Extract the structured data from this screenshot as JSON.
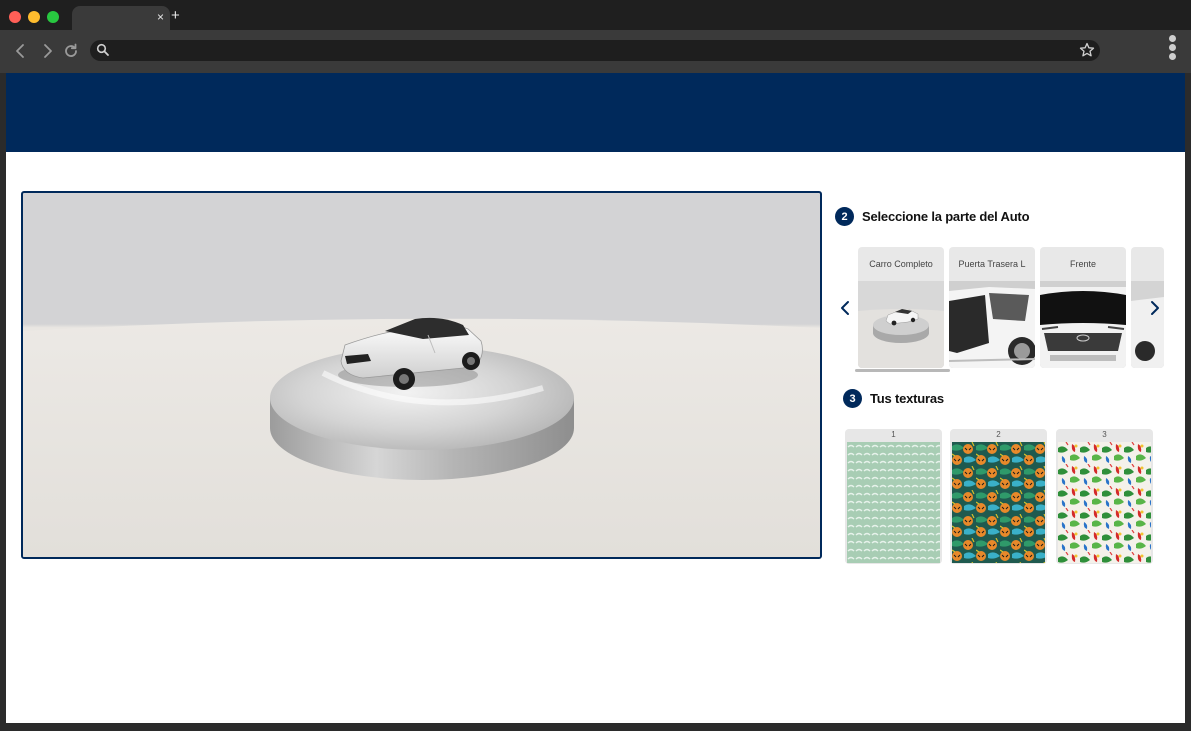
{
  "browser": {
    "tab_title": "",
    "tab_close": "×",
    "new_tab": "+",
    "url": "",
    "icons": [
      "back-icon",
      "forward-icon",
      "reload-icon",
      "search-icon",
      "star-icon",
      "menu-icon"
    ]
  },
  "colors": {
    "brand_navy": "#00295b",
    "chrome_dark": "#1f1f1f",
    "chrome_toolbar": "#3a3a3a"
  },
  "steps": {
    "part": {
      "number": "2",
      "title": "Seleccione la parte del Auto"
    },
    "textures": {
      "number": "3",
      "title": "Tus texturas"
    }
  },
  "parts": [
    {
      "label": "Carro Completo"
    },
    {
      "label": "Puerta Trasera L"
    },
    {
      "label": "Frente"
    }
  ],
  "textures": [
    {
      "number": "1"
    },
    {
      "number": "2"
    },
    {
      "number": "3"
    }
  ]
}
